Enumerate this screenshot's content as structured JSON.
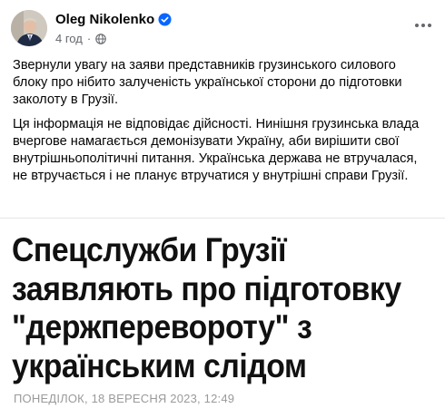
{
  "post": {
    "author": "Oleg Nikolenko",
    "time": "4 год",
    "paragraphs": [
      "Звернули увагу на заяви представників грузинського силового блоку про нібито залученість української сторони до підготовки заколоту в Грузії.",
      "Ця інформація не відповідає дійсності. Нинішня грузинська влада вчергове намагається демонізувати Україну, аби вирішити свої внутрішньополітичні питання. Українська держава не втручалася, не втручається і не планує втручатися у внутрішні справи Грузії."
    ]
  },
  "icons": {
    "verified": "verified-badge-icon",
    "audience": "globe-icon",
    "menu": "more-options-icon"
  },
  "article": {
    "headline_lines": [
      "Спецслужби Грузії",
      "заявляють про підготовку",
      "\"держперевороту\" з",
      "українським слідом"
    ],
    "dateline": "ПОНЕДІЛОК, 18 ВЕРЕСНЯ 2023, 12:49"
  },
  "colors": {
    "verified_blue": "#0866ff",
    "secondary_text": "#65676b",
    "dateline_gray": "#9a9a9a"
  }
}
